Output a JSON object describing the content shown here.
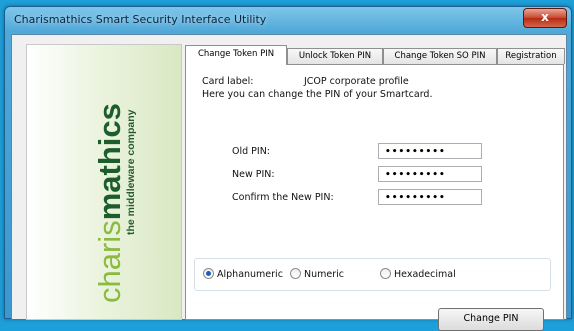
{
  "window": {
    "title": "Charismathics Smart Security Interface Utility",
    "close_glyph": "x"
  },
  "brand": {
    "logo_prefix": "charis",
    "logo_suffix": "mathics",
    "tagline": "the middleware company",
    "colors": {
      "prefix": "#8bbb3e",
      "suffix": "#1c5d2b",
      "tagline": "#245a30"
    }
  },
  "tabs": [
    {
      "label": "Change Token PIN",
      "active": true
    },
    {
      "label": "Unlock Token PIN",
      "active": false
    },
    {
      "label": "Change Token SO PIN",
      "active": false
    },
    {
      "label": "Registration",
      "active": false
    }
  ],
  "panel": {
    "card_label_caption": "Card label:",
    "card_label_value": "JCOP corporate profile",
    "description": "Here you can change the PIN of your Smartcard.",
    "fields": {
      "old_pin": {
        "label": "Old PIN:",
        "value": "•••••••••"
      },
      "new_pin": {
        "label": "New PIN:",
        "value": "•••••••••"
      },
      "confirm_pin": {
        "label": "Confirm the New PIN:",
        "value": "•••••••••"
      }
    },
    "radios": {
      "alphanumeric": {
        "label": "Alphanumeric",
        "checked": true
      },
      "numeric": {
        "label": "Numeric",
        "checked": false
      },
      "hexadecimal": {
        "label": "Hexadecimal",
        "checked": false
      }
    },
    "change_button": "Change PIN"
  }
}
